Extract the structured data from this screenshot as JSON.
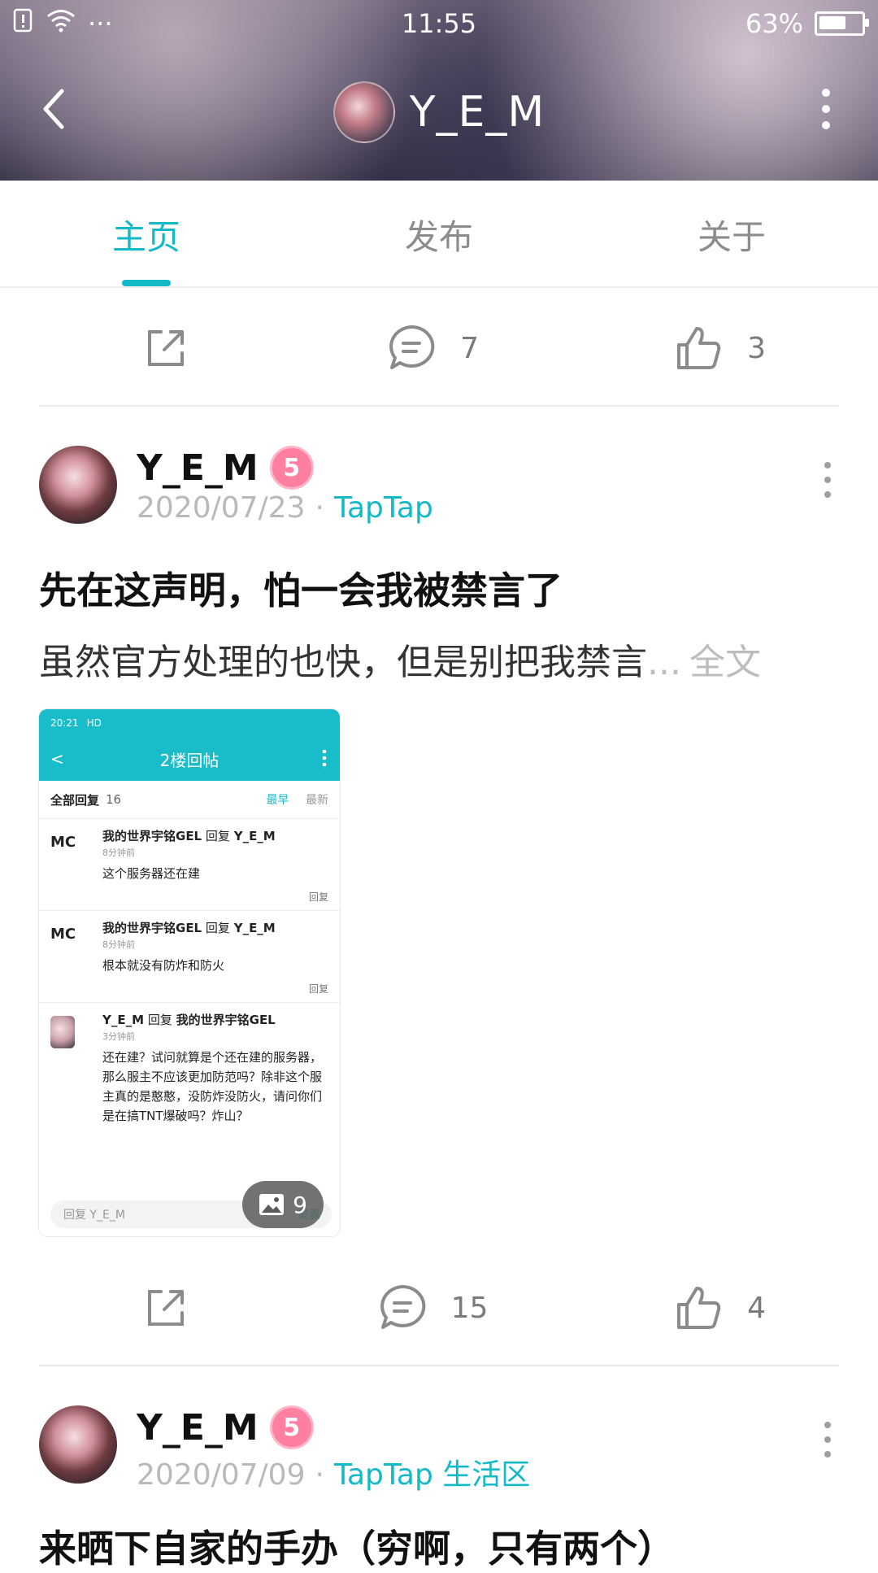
{
  "status_bar": {
    "time": "11:55",
    "battery_percent": "63%",
    "battery_level": 0.63,
    "more_symbol": "···"
  },
  "header": {
    "username": "Y_E_M"
  },
  "tabs": [
    {
      "label": "主页",
      "active": true
    },
    {
      "label": "发布",
      "active": false
    },
    {
      "label": "关于",
      "active": false
    }
  ],
  "top_actions": {
    "comments": "7",
    "likes": "3"
  },
  "post1": {
    "author": "Y_E_M",
    "level": "5",
    "date": "2020/07/23",
    "tag": "TapTap",
    "title": "先在这声明，怕一会我被禁言了",
    "body": "虽然官方处理的也快，但是别把我禁言",
    "ellipsis": "...",
    "more": "全文",
    "image_count": "9",
    "comments": "15",
    "likes": "4"
  },
  "post1_image": {
    "status_time": "20:21",
    "status_hd": "HD",
    "bar_title": "2楼回帖",
    "all_replies": "全部回复",
    "reply_count": "16",
    "sort_earliest": "最早",
    "sort_newest": "最新",
    "replies": [
      {
        "avatar": "MC",
        "user": "我的世界宇铭GEL",
        "reply_word": "回复",
        "reply_to": "Y_E_M",
        "time": "8分钟前",
        "text": "这个服务器还在建",
        "reply_btn": "回复"
      },
      {
        "avatar": "MC",
        "user": "我的世界宇铭GEL",
        "reply_word": "回复",
        "reply_to": "Y_E_M",
        "time": "8分钟前",
        "text": "根本就没有防炸和防火",
        "reply_btn": "回复"
      },
      {
        "avatar": "",
        "user": "Y_E_M",
        "reply_word": "回复",
        "reply_to": "我的世界宇铭GEL",
        "time": "3分钟前",
        "text": "还在建？试问就算是个还在建的服务器，那么服主不应该更加防范吗？除非这个服主真的是憨憨，没防炸没防火，请问你们是在搞TNT爆破吗？炸山？",
        "reply_btn": ""
      }
    ],
    "input_placeholder": "回复 Y_E_M",
    "send": "发表"
  },
  "post2": {
    "author": "Y_E_M",
    "level": "5",
    "date": "2020/07/09",
    "tag": "TapTap 生活区",
    "title": "来晒下自家的手办（穷啊，只有两个）"
  },
  "colors": {
    "accent": "#14b9c8",
    "muted": "#b9b9b9",
    "level_badge": "#ff7fa1"
  }
}
